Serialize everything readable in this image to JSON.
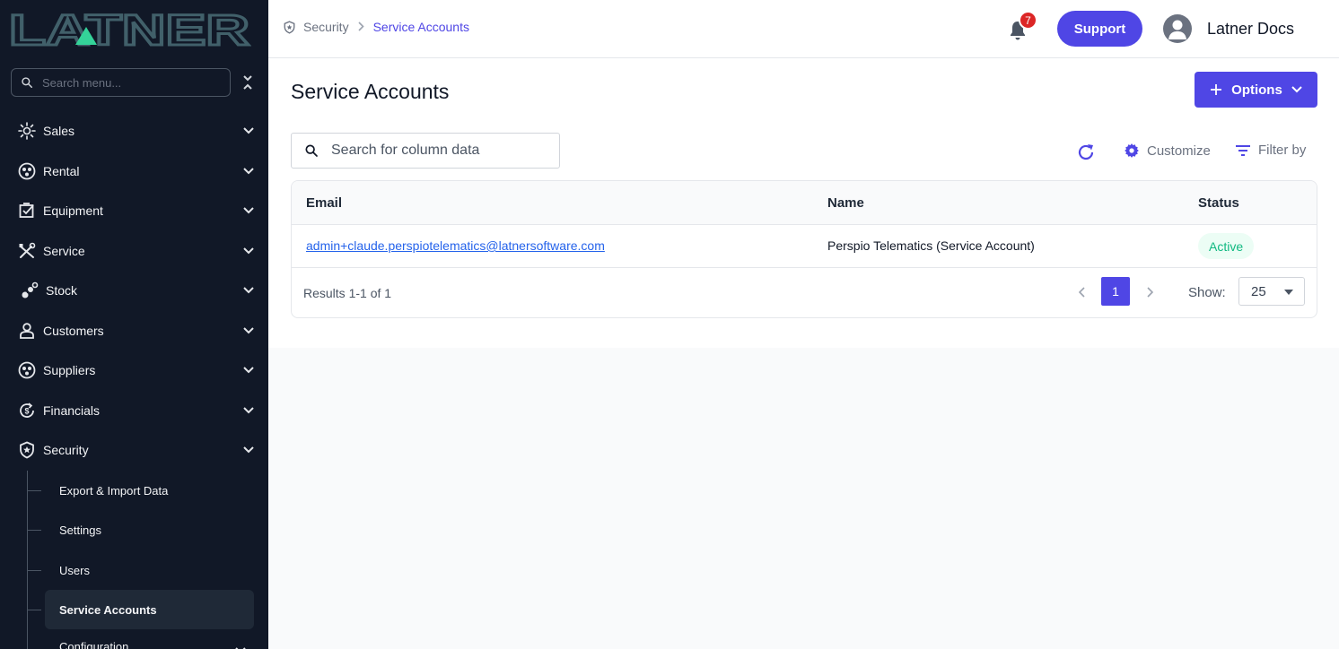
{
  "brand": {
    "logo_text": "LATNER"
  },
  "sidebar": {
    "search_placeholder": "Search menu...",
    "items": [
      {
        "label": "Sales",
        "icon": "sales-icon"
      },
      {
        "label": "Rental",
        "icon": "rental-icon"
      },
      {
        "label": "Equipment",
        "icon": "equipment-icon"
      },
      {
        "label": "Service",
        "icon": "service-tools-icon"
      },
      {
        "label": "Stock",
        "icon": "stock-icon"
      },
      {
        "label": "Customers",
        "icon": "customers-icon"
      },
      {
        "label": "Suppliers",
        "icon": "suppliers-icon"
      },
      {
        "label": "Financials",
        "icon": "financials-icon"
      },
      {
        "label": "Security",
        "icon": "shield-icon"
      }
    ],
    "security_subitems": [
      {
        "label": "Export & Import Data"
      },
      {
        "label": "Settings"
      },
      {
        "label": "Users"
      },
      {
        "label": "Service Accounts",
        "active": true
      },
      {
        "label": "Configuration"
      }
    ]
  },
  "header": {
    "breadcrumb": {
      "parent": "Security",
      "current": "Service Accounts"
    },
    "notifications_count": "7",
    "support_label": "Support",
    "user_name": "Latner Docs"
  },
  "page": {
    "title": "Service Accounts",
    "options_label": "Options",
    "search_placeholder": "Search for column data",
    "customize_label": "Customize",
    "filter_label": "Filter by"
  },
  "table": {
    "columns": [
      "Email",
      "Name",
      "Status"
    ],
    "rows": [
      {
        "email": "admin+claude.perspiotelematics@latnersoftware.com",
        "name": "Perspio Telematics (Service Account)",
        "status": "Active"
      }
    ],
    "results_text": "Results 1-1 of 1",
    "current_page": "1",
    "show_label": "Show:",
    "page_size": "25"
  },
  "colors": {
    "sidebar_bg": "#111827",
    "accent": "#4f46e5",
    "link": "#2563eb",
    "status_active": "#10b981",
    "badge_red": "#dc2626"
  }
}
